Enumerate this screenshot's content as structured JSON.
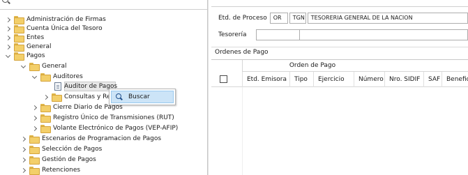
{
  "tree": {
    "items": [
      {
        "label": "Administración de Firmas",
        "state": "collapsed"
      },
      {
        "label": "Cuenta Única del Tesoro",
        "state": "collapsed"
      },
      {
        "label": "Entes",
        "state": "collapsed"
      },
      {
        "label": "General",
        "state": "collapsed"
      },
      {
        "label": "Pagos",
        "state": "expanded"
      },
      {
        "label": "General",
        "state": "expanded"
      },
      {
        "label": "Auditores",
        "state": "expanded"
      },
      {
        "label": "Auditor de Pagos",
        "state": "selected"
      },
      {
        "label": "Consultas y Rep",
        "state": "collapsed"
      },
      {
        "label": "Cierre Diario de Pagos",
        "state": "collapsed"
      },
      {
        "label": "Registro Único de Transmisiones (RUT)",
        "state": "collapsed"
      },
      {
        "label": "Volante Electrónico de Pagos (VEP-AFIP)",
        "state": "collapsed"
      },
      {
        "label": "Escenarios de Programacion de Pagos",
        "state": "collapsed"
      },
      {
        "label": "Selección de Pagos",
        "state": "collapsed"
      },
      {
        "label": "Gestión de Pagos",
        "state": "collapsed"
      },
      {
        "label": "Retenciones",
        "state": "collapsed"
      }
    ]
  },
  "context_menu": {
    "items": [
      {
        "label": "Buscar",
        "icon": "search-icon"
      }
    ]
  },
  "form": {
    "etd_label": "Etd. de Proceso",
    "etd_code1": "OR",
    "etd_code2": "TGN",
    "etd_desc": "TESORERIA GENERAL DE LA NACION",
    "tesoreria_label": "Tesorería",
    "tesoreria_value_small": "",
    "tesoreria_value_big": ""
  },
  "ordenes": {
    "title": "Ordenes de Pago",
    "group_header": "Orden de Pago",
    "columns": [
      "Etd. Emisora",
      "Tipo",
      "Ejercicio",
      "Número",
      "Nro. SIDIF",
      "SAF",
      "Benefic"
    ]
  },
  "colors": {
    "menu_highlight": "#cce4f7",
    "folder": "#f3cf6a"
  }
}
